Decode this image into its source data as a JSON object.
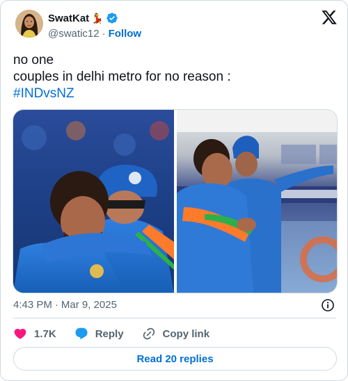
{
  "user": {
    "display_name": "SwatKat",
    "emoji": "💃",
    "handle": "@swatic12",
    "separator": "·",
    "follow_label": "Follow"
  },
  "tweet": {
    "line1": "no one",
    "line2": "couples in delhi metro for no reason :",
    "hashtag": "#INDvsNZ"
  },
  "meta": {
    "time": "4:43 PM",
    "separator": "·",
    "date": "Mar 9, 2025"
  },
  "actions": {
    "likes": "1.7K",
    "reply_label": "Reply",
    "copy_label": "Copy link"
  },
  "read_replies_label": "Read 20 replies",
  "colors": {
    "link": "#006fd6",
    "like": "#f91880",
    "reply": "#1d9bf0",
    "verified": "#1d9bf0",
    "border": "#cfd9de",
    "muted": "#536471"
  },
  "icons": [
    "x-logo-icon",
    "verified-badge-icon",
    "info-icon",
    "heart-icon",
    "reply-bubble-icon",
    "link-icon"
  ]
}
